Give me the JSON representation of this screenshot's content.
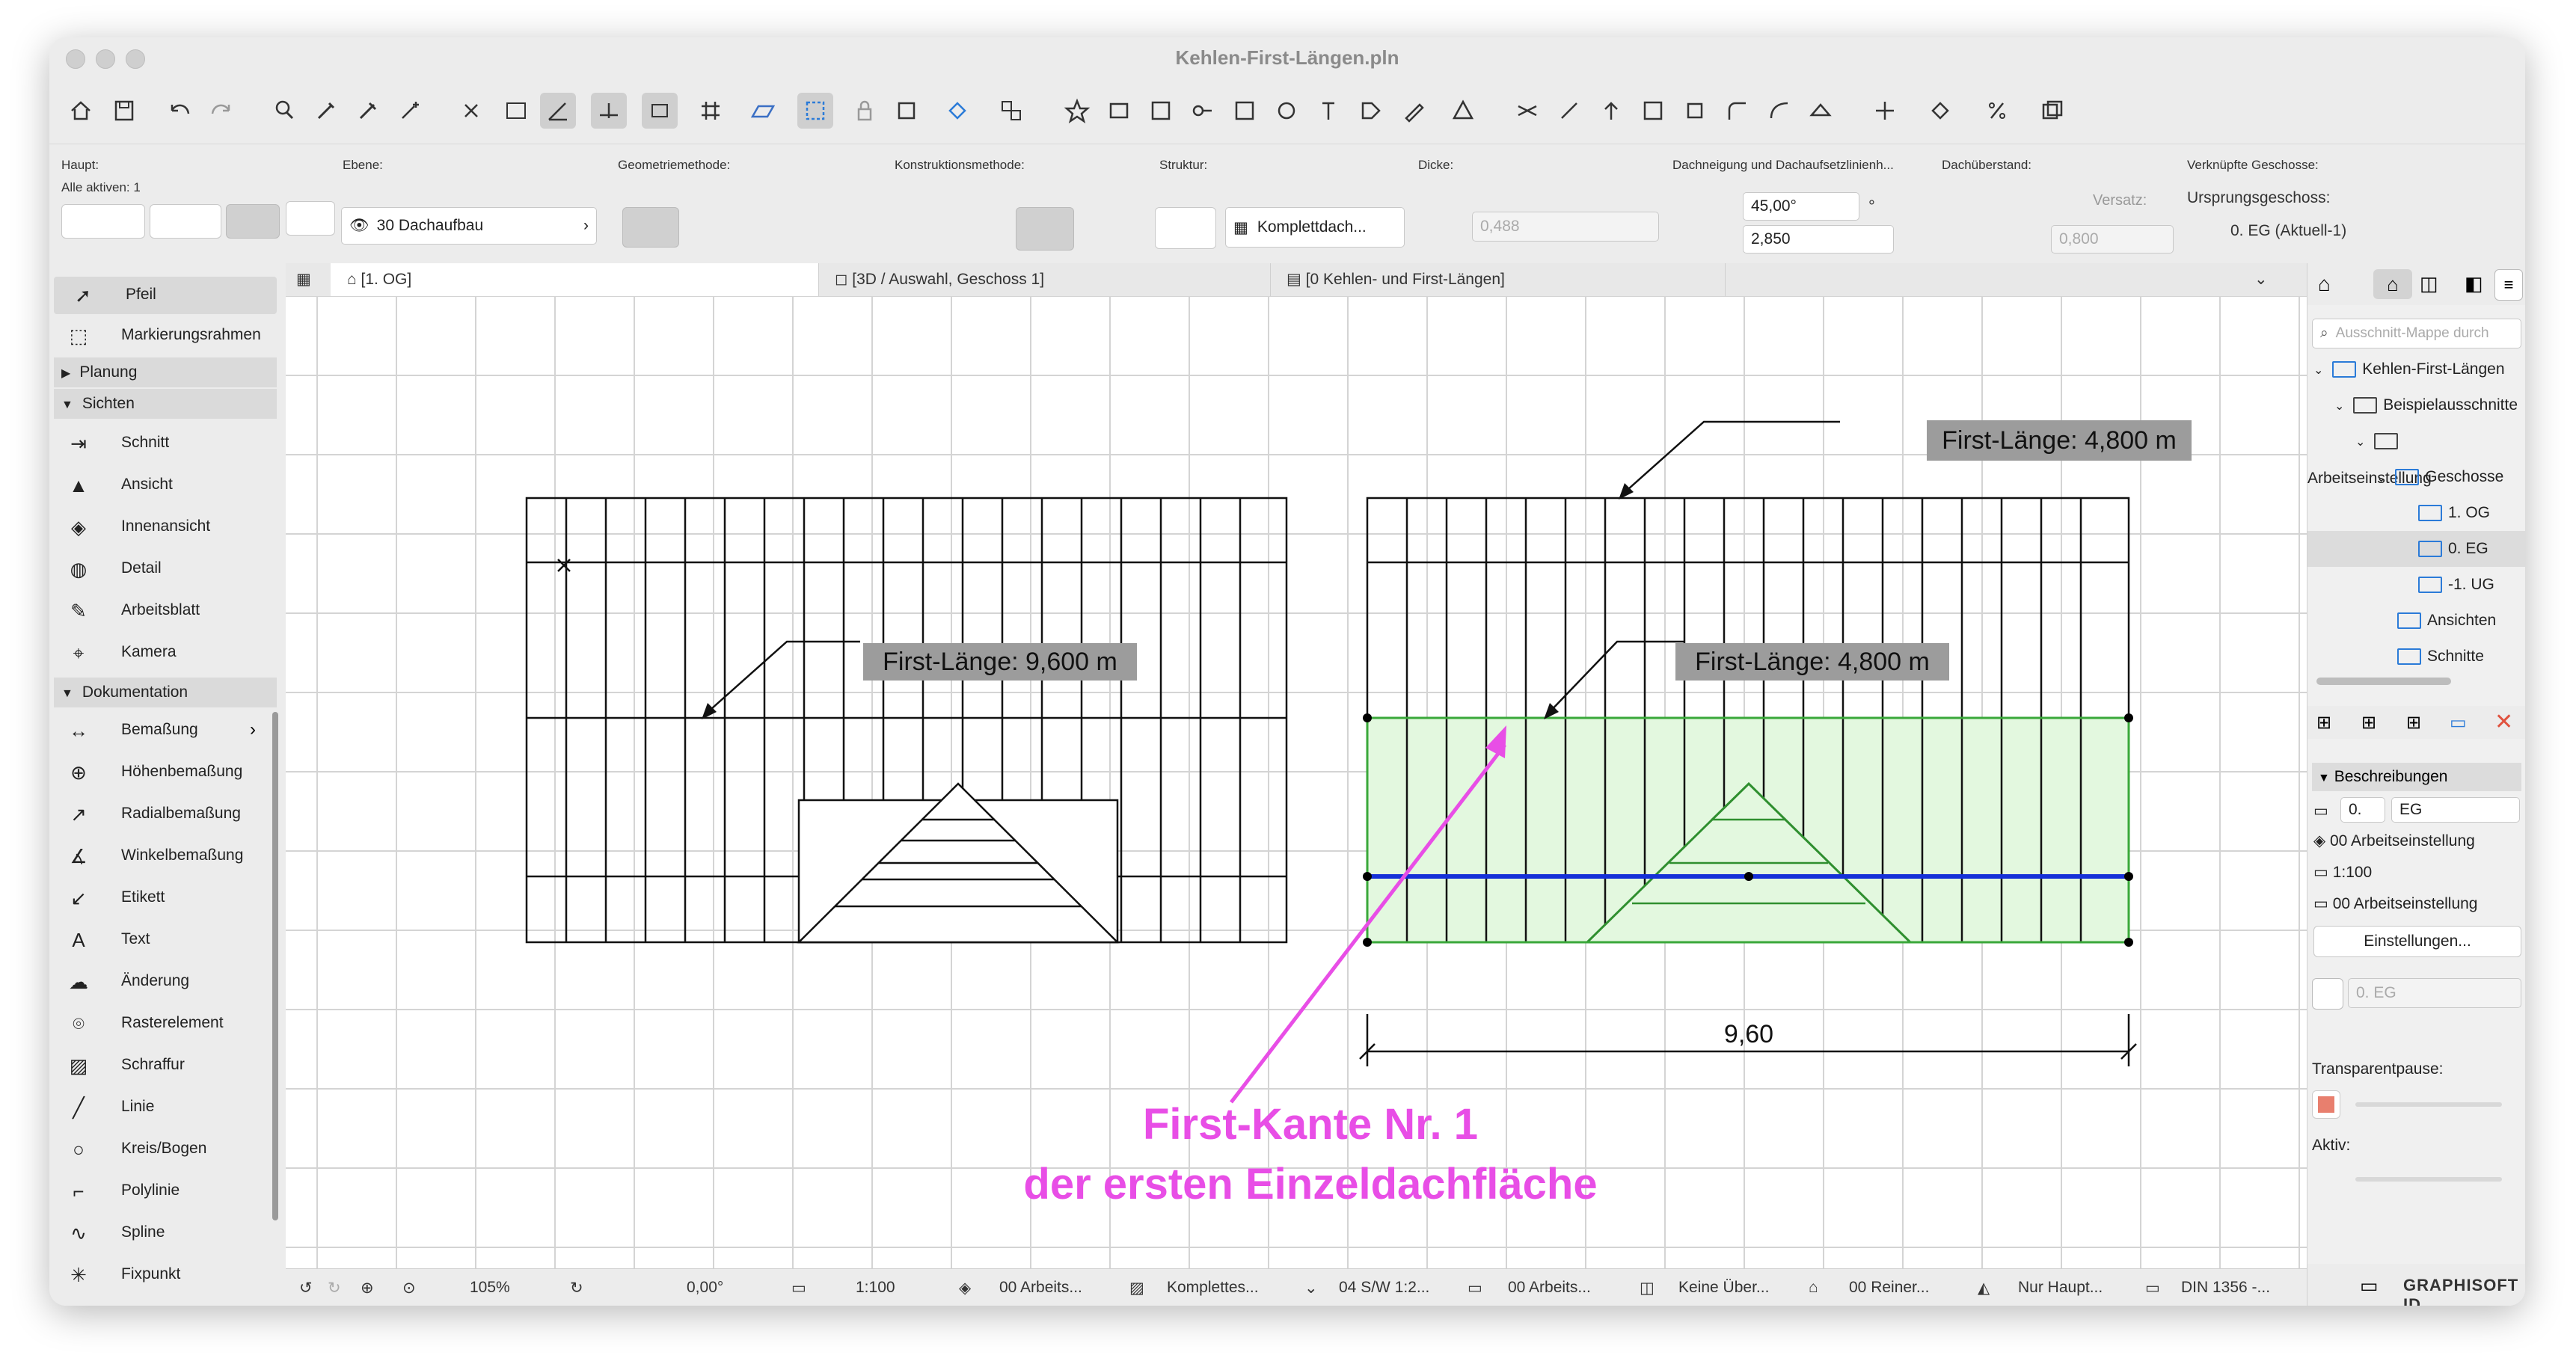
{
  "window": {
    "title": "Kehlen-First-Längen.pln"
  },
  "infobox": {
    "haupt": {
      "label": "Haupt:",
      "sub": "Alle aktiven: 1"
    },
    "ebene": {
      "label": "Ebene:",
      "value": "30 Dachaufbau"
    },
    "geometrie": {
      "label": "Geometriemethode:"
    },
    "konstruktion": {
      "label": "Konstruktionsmethode:"
    },
    "struktur": {
      "label": "Struktur:",
      "value": "Komplettdach..."
    },
    "dicke": {
      "label": "Dicke:",
      "value": "0,488"
    },
    "dachneigung": {
      "label": "Dachneigung und Dachaufsetzlinienh...",
      "angle": "45,00°",
      "unit": "°",
      "height": "2,850"
    },
    "ueberstand": {
      "label": "Dachüberstand:",
      "versatz_label": "Versatz:",
      "versatz_value": "0,800"
    },
    "geschosse": {
      "label": "Verknüpfte Geschosse:",
      "sub": "Ursprungsgeschoss:",
      "value": "0. EG (Aktuell-1)"
    }
  },
  "toolbox": {
    "tools_top": [
      {
        "label": "Pfeil",
        "icon": "arrow-cursor-icon"
      },
      {
        "label": "Markierungsrahmen",
        "icon": "marquee-icon"
      }
    ],
    "planung": "Planung",
    "sichten": "Sichten",
    "sichten_items": [
      {
        "label": "Schnitt"
      },
      {
        "label": "Ansicht"
      },
      {
        "label": "Innenansicht"
      },
      {
        "label": "Detail"
      },
      {
        "label": "Arbeitsblatt"
      },
      {
        "label": "Kamera"
      }
    ],
    "dokumentation": "Dokumentation",
    "doku_items": [
      {
        "label": "Bemaßung"
      },
      {
        "label": "Höhenbemaßung"
      },
      {
        "label": "Radialbemaßung"
      },
      {
        "label": "Winkelbemaßung"
      },
      {
        "label": "Etikett"
      },
      {
        "label": "Text"
      },
      {
        "label": "Änderung"
      },
      {
        "label": "Rasterelement"
      },
      {
        "label": "Schraffur"
      },
      {
        "label": "Linie"
      },
      {
        "label": "Kreis/Bogen"
      },
      {
        "label": "Polylinie"
      },
      {
        "label": "Spline"
      },
      {
        "label": "Fixpunkt"
      }
    ]
  },
  "tabs": [
    {
      "label": "[1. OG]"
    },
    {
      "label": "[3D / Auswahl, Geschoss 1]"
    },
    {
      "label": "[0 Kehlen- und First-Längen]"
    }
  ],
  "canvas": {
    "label_left": "First-Länge: 9,600 m",
    "label_mid": "First-Länge: 4,800 m",
    "label_top": "First-Länge: 4,800 m",
    "dimension": "9,60",
    "annotation_line1": "First-Kante Nr. 1",
    "annotation_line2": "der ersten Einzeldachfläche",
    "annotation_color": "#e84ee6"
  },
  "statusbar": {
    "zoom": "105%",
    "angle": "0,00°",
    "scale": "1:100",
    "layer": "00 Arbeits...",
    "structure": "Komplettes...",
    "pen": "04 S/W 1:2...",
    "model": "00 Arbeits...",
    "override": "Keine Über...",
    "renovation": "00 Reiner...",
    "structure_display": "Nur Haupt...",
    "dimension": "DIN 1356 -..."
  },
  "navigator": {
    "search_placeholder": "Ausschnitt-Mappe durch",
    "tree": [
      {
        "label": "Kehlen-First-Längen",
        "level": 0
      },
      {
        "label": "Beispielausschnitte",
        "level": 1
      },
      {
        "label": "Arbeitseinstellung",
        "level": 2
      },
      {
        "label": "Geschosse",
        "level": 3
      },
      {
        "label": "1. OG",
        "level": 4
      },
      {
        "label": "0. EG",
        "level": 4
      },
      {
        "label": "-1. UG",
        "level": 4
      },
      {
        "label": "Ansichten",
        "level": 3
      },
      {
        "label": "Schnitte",
        "level": 3
      }
    ],
    "beschreibungen": "Beschreibungen",
    "desc_num": "0.",
    "desc_name": "EG",
    "desc_rows": [
      "00 Arbeitseinstellung",
      "1:100",
      "00 Arbeitseinstellung"
    ],
    "einstellungen": "Einstellungen...",
    "geschoss_field": "0. EG",
    "transparent_label": "Transparentpause:",
    "aktiv_label": "Aktiv:",
    "brand": "GRAPHISOFT ID"
  }
}
